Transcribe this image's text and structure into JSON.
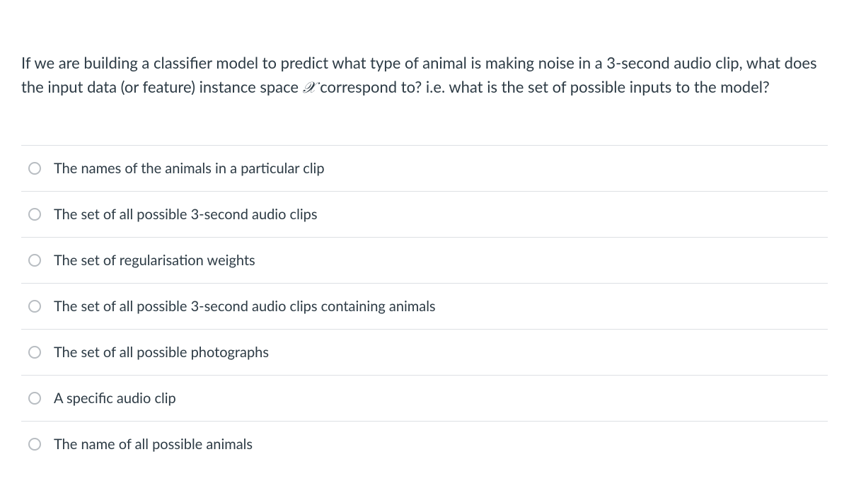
{
  "question": {
    "text_before": "If we are building a classifier model to predict what type of animal is making noise in a 3-second audio clip, what does the input data (or feature) instance space ",
    "variable": "𝒳",
    "text_after": " correspond to? i.e. what is the set of possible inputs to the model?"
  },
  "options": [
    {
      "label": "The names of the animals in a particular clip"
    },
    {
      "label": "The set of all possible 3-second audio clips"
    },
    {
      "label": "The set of regularisation weights"
    },
    {
      "label": "The set of all possible 3-second audio clips containing animals"
    },
    {
      "label": "The set of all possible photographs"
    },
    {
      "label": "A specific audio clip"
    },
    {
      "label": "The name of all possible animals"
    }
  ]
}
